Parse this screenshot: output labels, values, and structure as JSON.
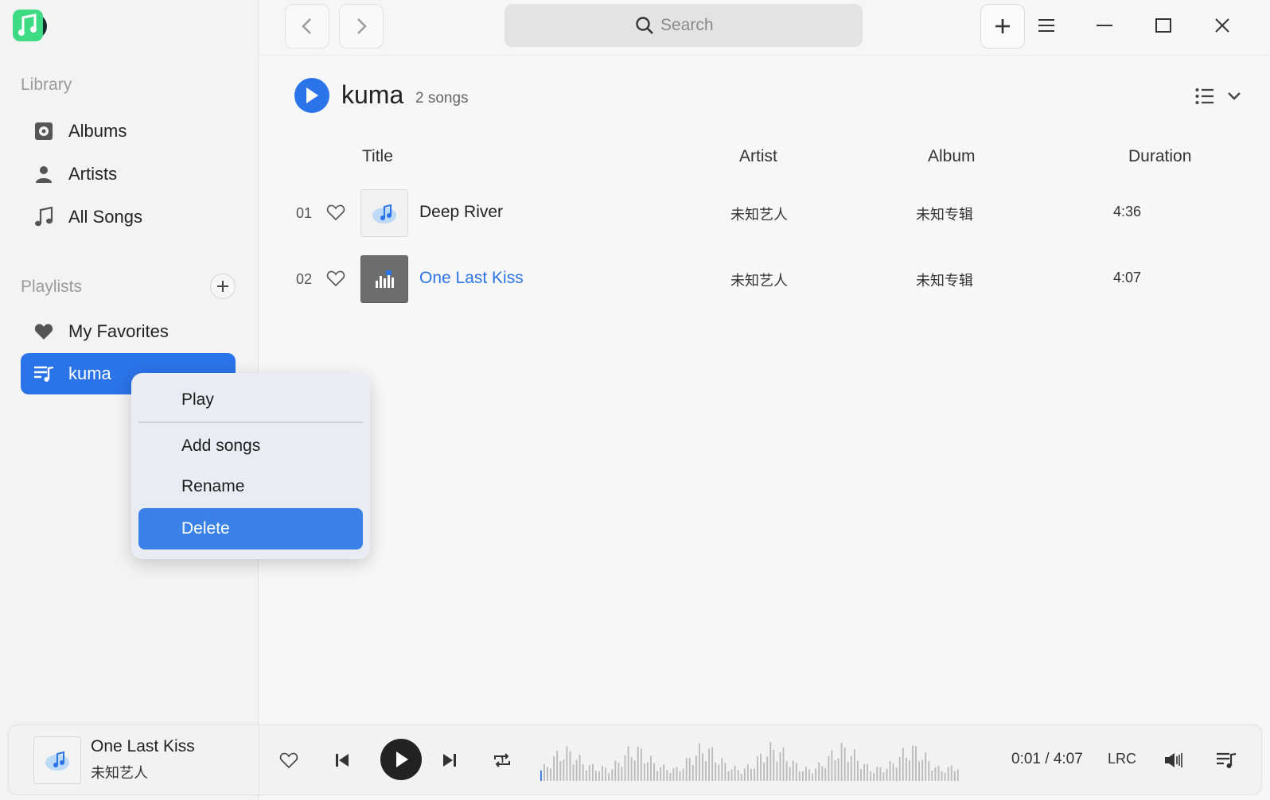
{
  "sidebar": {
    "library_title": "Library",
    "library_items": [
      {
        "label": "Albums",
        "icon": "album-icon"
      },
      {
        "label": "Artists",
        "icon": "artist-icon"
      },
      {
        "label": "All Songs",
        "icon": "music-note-icon"
      }
    ],
    "playlists_title": "Playlists",
    "playlists": [
      {
        "label": "My Favorites",
        "icon": "heart-icon"
      },
      {
        "label": "kuma",
        "icon": "playlist-icon",
        "active": true
      }
    ]
  },
  "topbar": {
    "search_placeholder": "Search"
  },
  "playlist": {
    "title": "kuma",
    "count_text": "2 songs"
  },
  "table": {
    "columns": [
      "Title",
      "Artist",
      "Album",
      "Duration"
    ],
    "rows": [
      {
        "num": "01",
        "title": "Deep River",
        "artist": "未知艺人",
        "album": "未知专辑",
        "duration": "4:36",
        "playing": false
      },
      {
        "num": "02",
        "title": "One Last Kiss",
        "artist": "未知艺人",
        "album": "未知专辑",
        "duration": "4:07",
        "playing": true
      }
    ]
  },
  "context_menu": {
    "items": [
      "Play",
      "Add songs",
      "Rename",
      "Delete"
    ],
    "selected": "Delete"
  },
  "player": {
    "title": "One Last Kiss",
    "artist": "未知艺人",
    "current_time": "0:01",
    "separator": "/",
    "total_time": "4:07",
    "lrc_label": "LRC",
    "progress": 0.004
  },
  "colors": {
    "accent": "#2b73e8",
    "logo_green": "#3ddc84",
    "menu_selected": "#3a82e8"
  }
}
